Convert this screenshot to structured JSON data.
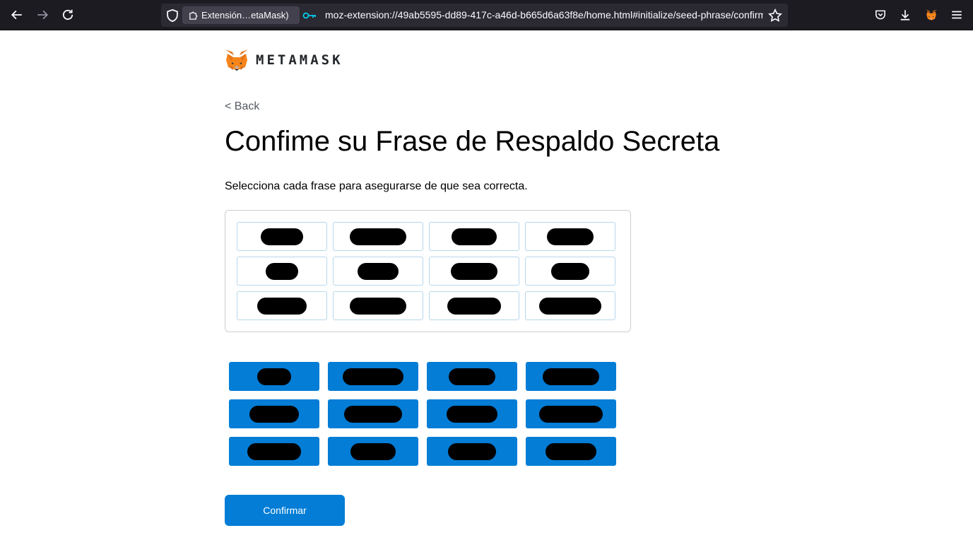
{
  "browser": {
    "extension_chip_label": "Extensión…etaMask)",
    "url": "moz-extension://49ab5595-dd89-417c-a46d-b665d6a63f8e/home.html#initialize/seed-phrase/confirm"
  },
  "header": {
    "brand_name": "METAMASK"
  },
  "page": {
    "back_label": "< Back",
    "title": "Confime su Frase de Respaldo Secreta",
    "subtitle": "Selecciona cada frase para asegurarse de que sea correcta.",
    "confirm_label": "Confirmar"
  },
  "colors": {
    "accent": "#037dd6",
    "slot_border": "#b6d7ea",
    "toolbar_bg": "#1c1b22"
  },
  "seed_words_note_redacted": true
}
